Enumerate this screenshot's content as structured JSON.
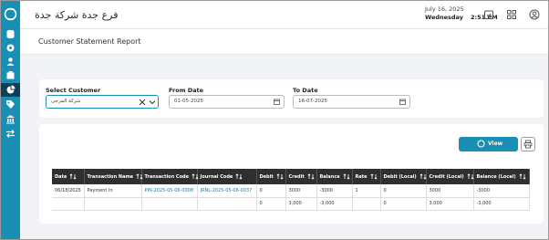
{
  "header": {
    "branch_title": "فرع جدة شركة جدة",
    "date": "July 16, 2025",
    "weekday": "Wednesday",
    "time": "2:51 PM",
    "icons": [
      "calendar-icon",
      "apps-grid-icon",
      "user-account-icon"
    ]
  },
  "page": {
    "title": "Customer Statement Report"
  },
  "filters": {
    "customer_label": "Select Customer",
    "customer_value": "شركة المرجى",
    "from_label": "From Date",
    "from_value": "01-05-2025",
    "to_label": "To Date",
    "to_value": "16-07-2025"
  },
  "actions": {
    "view_label": "View",
    "print_icon": "print-icon"
  },
  "table": {
    "columns": [
      "Date",
      "Transaction Name",
      "Transaction Code",
      "Journal Code",
      "Debit",
      "Credit",
      "Balance",
      "Rate",
      "Debit (Local)",
      "Credit (Local)",
      "Balance (Local)"
    ],
    "rows": [
      [
        "06/18/2025",
        "Payment In",
        "PIN-2025-05-06-0008",
        "JRNL-2025-05-06-0037",
        "0",
        "3000",
        "-3000",
        "1",
        "0",
        "3000",
        "-3000"
      ]
    ],
    "totals": [
      "",
      "",
      "",
      "",
      "0",
      "3,000",
      "-3,000",
      "",
      "0",
      "3,000",
      "-3,000"
    ]
  },
  "colors": {
    "sidebar": "#1a8fb5",
    "sidebar_active": "#0d3f57",
    "accent": "#1a8fb5",
    "table_header": "#2f2f2f"
  }
}
